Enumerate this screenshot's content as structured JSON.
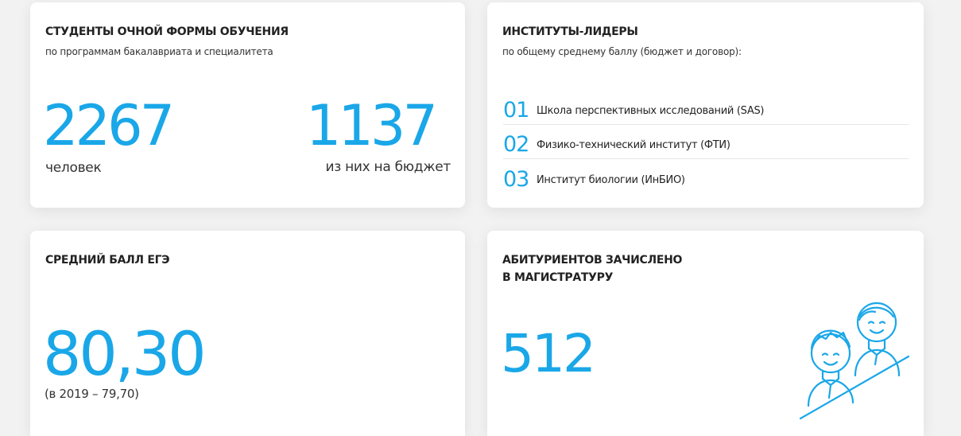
{
  "colors": {
    "accent": "#1aa7e8",
    "text": "#222222",
    "background": "#f2f2f2"
  },
  "students": {
    "title": "СТУДЕНТЫ ОЧНОЙ ФОРМЫ ОБУЧЕНИЯ",
    "subtitle": "по программам бакалавриата и специалитета",
    "total_value": "2267",
    "total_caption": "человек",
    "budget_value": "1137",
    "budget_caption": "из них на бюджет"
  },
  "leaders": {
    "title": "ИНСТИТУТЫ-ЛИДЕРЫ",
    "subtitle": "по общему среднему баллу (бюджет и договор):",
    "items": [
      {
        "rank": "01",
        "name": "Школа перспективных исследований (SAS)"
      },
      {
        "rank": "02",
        "name": "Физико-технический институт (ФТИ)"
      },
      {
        "rank": "03",
        "name": "Институт биологии (ИнБИО)"
      }
    ]
  },
  "exam": {
    "title": "СРЕДНИЙ БАЛЛ ЕГЭ",
    "value": "80,30",
    "caption": "(в 2019 – 79,70)"
  },
  "masters": {
    "title_line1": "АБИТУРИЕНТОВ ЗАЧИСЛЕНО",
    "title_line2": "В МАГИСТРАТУРУ",
    "value": "512",
    "illustration_icon": "students-icon"
  }
}
